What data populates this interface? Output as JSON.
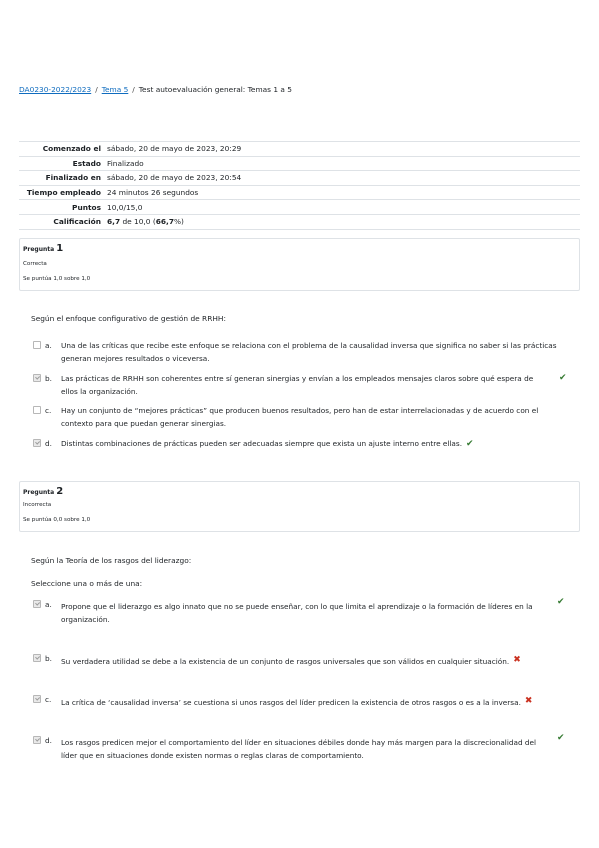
{
  "breadcrumb": {
    "course": "DA0230-2022/2023",
    "section": "Tema 5",
    "current": "Test autoevaluación general: Temas 1 a 5"
  },
  "summary": {
    "rows": [
      {
        "label": "Comenzado el",
        "value": "sábado, 20 de mayo de 2023, 20:29"
      },
      {
        "label": "Estado",
        "value": "Finalizado"
      },
      {
        "label": "Finalizado en",
        "value": "sábado, 20 de mayo de 2023, 20:54"
      },
      {
        "label": "Tiempo empleado",
        "value": "24 minutos 26 segundos"
      },
      {
        "label": "Puntos",
        "value": "10,0/15,0"
      }
    ],
    "grade_label": "Calificación",
    "grade_value_a": "6,7",
    "grade_value_b": " de 10,0 (",
    "grade_value_c": "66,7",
    "grade_value_d": "%)"
  },
  "q1": {
    "word": "Pregunta",
    "number": "1",
    "state": "Correcta",
    "grade": "Se puntúa 1,0 sobre 1,0",
    "text": "Según el enfoque configurativo de gestión de RRHH:",
    "answers": [
      {
        "letter": "a.",
        "line1": "Una de las críticas que recibe este enfoque se relaciona con el problema de la causalidad inversa que significa no saber si las prácticas",
        "line2": "generan mejores resultados o viceversa."
      },
      {
        "letter": "b.",
        "line1": "Las prácticas de RRHH son coherentes entre sí generan sinergias y envían a los empleados mensajes claros sobre qué espera de",
        "line2": "ellos la organización."
      },
      {
        "letter": "c.",
        "line1": "Hay un conjunto de “mejores prácticas” que producen buenos resultados, pero han de estar interrelacionadas y de acuerdo con el",
        "line2": "contexto para que puedan generar sinergias."
      },
      {
        "letter": "d.",
        "line1": "Distintas combinaciones de prácticas pueden ser adecuadas siempre que exista un ajuste interno entre ellas.",
        "line2": ""
      }
    ]
  },
  "q2": {
    "word": "Pregunta",
    "number": "2",
    "state": "Incorrecta",
    "grade": "Se puntúa 0,0 sobre 1,0",
    "text": "Según la Teoría de los rasgos del liderazgo:",
    "prompt": "Seleccione una o más de una:",
    "answers": [
      {
        "letter": "a.",
        "line1": "Propone que el liderazgo es algo innato que no se puede enseñar, con lo que limita el aprendizaje o la formación de líderes en la",
        "line2": "organización."
      },
      {
        "letter": "b.",
        "line1": "Su verdadera utilidad se debe a la existencia de un conjunto de rasgos universales que son válidos en cualquier situación.",
        "line2": ""
      },
      {
        "letter": "c.",
        "line1": "La crítica de ‘causalidad inversa’ se cuestiona si unos rasgos del líder predicen la existencia de otros rasgos o es a la inversa.",
        "line2": ""
      },
      {
        "letter": "d.",
        "line1": "Los rasgos predicen mejor el comportamiento del líder en situaciones débiles donde hay más margen para la discrecionalidad del",
        "line2": "líder que en situaciones donde existen normas o reglas claras de comportamiento."
      }
    ]
  },
  "icons": {
    "correct": "✔",
    "incorrect": "✖",
    "correct_color": "#357a32",
    "incorrect_color": "#ca3120"
  }
}
